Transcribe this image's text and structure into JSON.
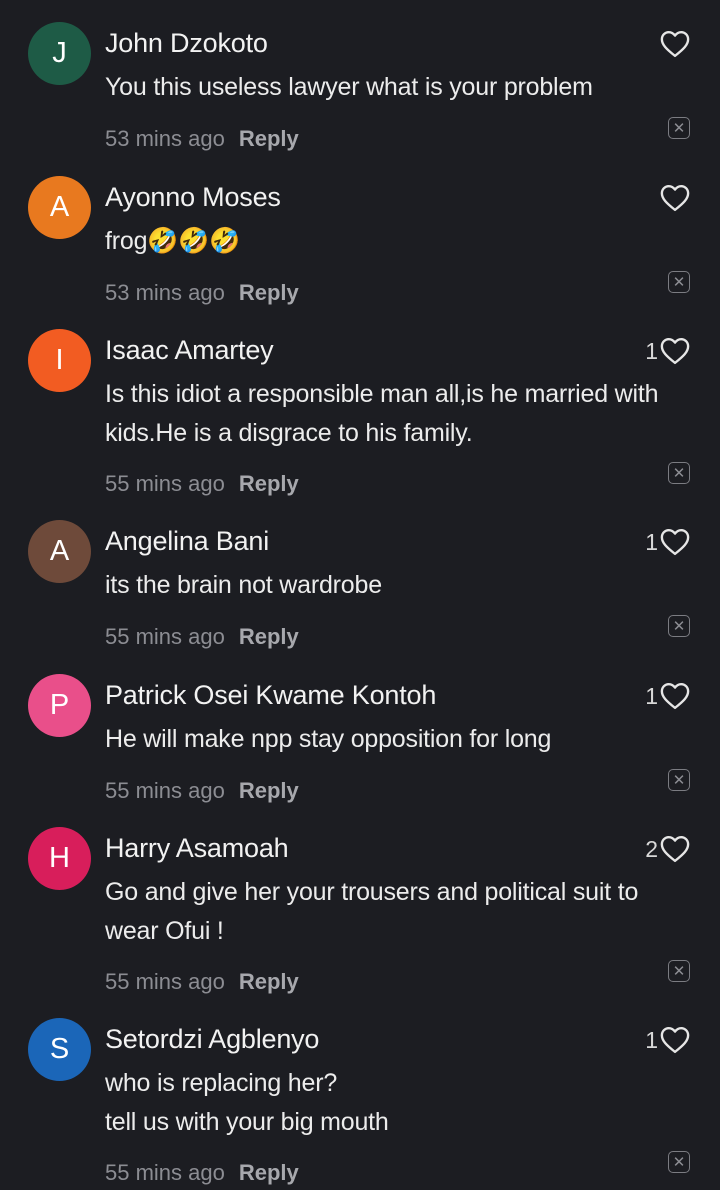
{
  "comments": [
    {
      "avatar_letter": "J",
      "avatar_color": "#1e5b46",
      "name": "John Dzokoto",
      "lines": [
        "You this useless lawyer what is your problem"
      ],
      "time": "53 mins ago",
      "reply_label": "Reply",
      "likes": ""
    },
    {
      "avatar_letter": "A",
      "avatar_color": "#e8791f",
      "name": "Ayonno Moses",
      "lines": [
        "frog🤣🤣🤣"
      ],
      "time": "53 mins ago",
      "reply_label": "Reply",
      "likes": ""
    },
    {
      "avatar_letter": "I",
      "avatar_color": "#f25c22",
      "name": "Isaac Amartey",
      "lines": [
        "Is this idiot a responsible man all,is he married with",
        "kids.He is a disgrace to his family."
      ],
      "time": "55 mins ago",
      "reply_label": "Reply",
      "likes": "1"
    },
    {
      "avatar_letter": "A",
      "avatar_color": "#6e4a3a",
      "name": "Angelina Bani",
      "lines": [
        "its the brain not wardrobe"
      ],
      "time": "55 mins ago",
      "reply_label": "Reply",
      "likes": "1"
    },
    {
      "avatar_letter": "P",
      "avatar_color": "#e94f8a",
      "name": "Patrick Osei Kwame Kontoh",
      "lines": [
        "He will make npp stay opposition for long"
      ],
      "time": "55 mins ago",
      "reply_label": "Reply",
      "likes": "1"
    },
    {
      "avatar_letter": "H",
      "avatar_color": "#d81e5b",
      "name": "Harry Asamoah",
      "lines": [
        "Go and give her your trousers  and political suit to",
        "wear  Ofui  !"
      ],
      "time": "55 mins ago",
      "reply_label": "Reply",
      "likes": "2"
    },
    {
      "avatar_letter": "S",
      "avatar_color": "#1b66b8",
      "name": "Setordzi Agblenyo",
      "lines": [
        "who is replacing her?",
        "tell us with your big mouth"
      ],
      "time": "55 mins ago",
      "reply_label": "Reply",
      "likes": "1"
    }
  ],
  "icons": {
    "like": "heart-icon",
    "dismiss": "close-icon"
  }
}
